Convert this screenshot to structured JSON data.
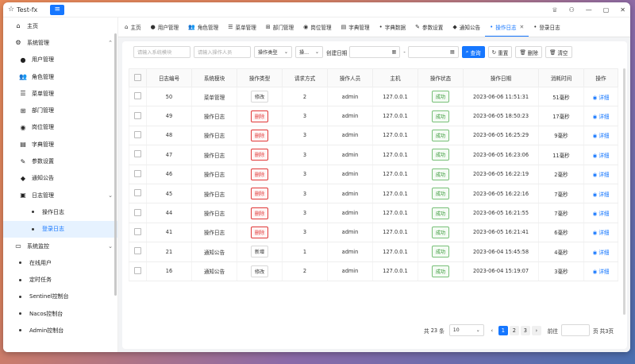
{
  "app": {
    "title": "Test-fx"
  },
  "sidebar": {
    "items": [
      {
        "label": "主页",
        "icon": "home-icon",
        "glyph": "⌂",
        "level": 0
      },
      {
        "label": "系统管理",
        "icon": "gear-icon",
        "glyph": "⚙",
        "level": 0,
        "chev": "⌃"
      },
      {
        "label": "用户管理",
        "icon": "user-icon",
        "glyph": "●",
        "level": 1
      },
      {
        "label": "角色管理",
        "icon": "users-icon",
        "glyph": "👥",
        "level": 1
      },
      {
        "label": "菜单管理",
        "icon": "menu-list-icon",
        "glyph": "☰",
        "level": 1
      },
      {
        "label": "部门管理",
        "icon": "org-chart-icon",
        "glyph": "⊞",
        "level": 1
      },
      {
        "label": "岗位管理",
        "icon": "person-badge-icon",
        "glyph": "◉",
        "level": 1
      },
      {
        "label": "字典管理",
        "icon": "book-icon",
        "glyph": "▤",
        "level": 1
      },
      {
        "label": "参数设置",
        "icon": "edit-icon",
        "glyph": "✎",
        "level": 1
      },
      {
        "label": "通知公告",
        "icon": "message-icon",
        "glyph": "◆",
        "level": 1
      },
      {
        "label": "日志管理",
        "icon": "log-icon",
        "glyph": "▣",
        "level": 1,
        "chev": "⌄"
      },
      {
        "label": "操作日志",
        "icon": "dot-icon",
        "glyph": "",
        "level": 2
      },
      {
        "label": "登录日志",
        "icon": "dot-icon",
        "glyph": "",
        "level": 2,
        "active": true
      },
      {
        "label": "系统监控",
        "icon": "monitor-icon",
        "glyph": "▭",
        "level": 0,
        "chev": "⌄"
      },
      {
        "label": "在线用户",
        "icon": "dot-icon",
        "glyph": "",
        "level": 1
      },
      {
        "label": "定时任务",
        "icon": "dot-icon",
        "glyph": "",
        "level": 1
      },
      {
        "label": "Sentinel控制台",
        "icon": "dot-icon",
        "glyph": "",
        "level": 1
      },
      {
        "label": "Nacos控制台",
        "icon": "dot-icon",
        "glyph": "",
        "level": 1
      },
      {
        "label": "Admin控制台",
        "icon": "dot-icon",
        "glyph": "",
        "level": 1
      }
    ]
  },
  "tabs": [
    {
      "label": "主页",
      "icon": "home-icon",
      "glyph": "⌂"
    },
    {
      "label": "用户管理",
      "icon": "user-icon",
      "glyph": "●"
    },
    {
      "label": "角色管理",
      "icon": "users-icon",
      "glyph": "👥"
    },
    {
      "label": "菜单管理",
      "icon": "menu-list-icon",
      "glyph": "☰"
    },
    {
      "label": "部门管理",
      "icon": "org-chart-icon",
      "glyph": "⊞"
    },
    {
      "label": "岗位管理",
      "icon": "person-badge-icon",
      "glyph": "◉"
    },
    {
      "label": "字典管理",
      "icon": "book-icon",
      "glyph": "▤"
    },
    {
      "label": "字典数据",
      "icon": "dot-icon",
      "glyph": "•"
    },
    {
      "label": "参数设置",
      "icon": "edit-icon",
      "glyph": "✎"
    },
    {
      "label": "通知公告",
      "icon": "message-icon",
      "glyph": "◆"
    },
    {
      "label": "操作日志",
      "icon": "dot-icon",
      "glyph": "•",
      "active": true,
      "close": "✕"
    },
    {
      "label": "登录日志",
      "icon": "dot-icon",
      "glyph": "•"
    }
  ],
  "filters": {
    "module_placeholder": "请输入系统模块",
    "operator_placeholder": "请输入操作人员",
    "op_type": "操作类型",
    "status": "操...",
    "create_date_label": "创建日期",
    "date_sep": "-",
    "search": "查询",
    "reset": "重置",
    "delete": "删除",
    "clear": "清空"
  },
  "table": {
    "headers": [
      "",
      "日志编号",
      "系统模块",
      "操作类型",
      "请求方式",
      "操作人员",
      "主机",
      "操作状态",
      "操作日期",
      "消耗时间",
      "操作"
    ],
    "detail_label": "详细",
    "rows": [
      {
        "id": "50",
        "module": "菜单管理",
        "type": "修改",
        "type_style": "default",
        "method": "2",
        "user": "admin",
        "host": "127.0.0.1",
        "status": "成功",
        "date": "2023-06-06 11:51:31",
        "cost": "51毫秒"
      },
      {
        "id": "49",
        "module": "操作日志",
        "type": "删除",
        "type_style": "danger",
        "method": "3",
        "user": "admin",
        "host": "127.0.0.1",
        "status": "成功",
        "date": "2023-06-05 18:50:23",
        "cost": "17毫秒"
      },
      {
        "id": "48",
        "module": "操作日志",
        "type": "删除",
        "type_style": "danger",
        "method": "3",
        "user": "admin",
        "host": "127.0.0.1",
        "status": "成功",
        "date": "2023-06-05 16:25:29",
        "cost": "9毫秒"
      },
      {
        "id": "47",
        "module": "操作日志",
        "type": "删除",
        "type_style": "danger",
        "method": "3",
        "user": "admin",
        "host": "127.0.0.1",
        "status": "成功",
        "date": "2023-06-05 16:23:06",
        "cost": "11毫秒"
      },
      {
        "id": "46",
        "module": "操作日志",
        "type": "删除",
        "type_style": "danger",
        "method": "3",
        "user": "admin",
        "host": "127.0.0.1",
        "status": "成功",
        "date": "2023-06-05 16:22:19",
        "cost": "2毫秒"
      },
      {
        "id": "45",
        "module": "操作日志",
        "type": "删除",
        "type_style": "danger",
        "method": "3",
        "user": "admin",
        "host": "127.0.0.1",
        "status": "成功",
        "date": "2023-06-05 16:22:16",
        "cost": "7毫秒"
      },
      {
        "id": "44",
        "module": "操作日志",
        "type": "删除",
        "type_style": "danger",
        "method": "3",
        "user": "admin",
        "host": "127.0.0.1",
        "status": "成功",
        "date": "2023-06-05 16:21:55",
        "cost": "7毫秒"
      },
      {
        "id": "41",
        "module": "操作日志",
        "type": "删除",
        "type_style": "danger",
        "method": "3",
        "user": "admin",
        "host": "127.0.0.1",
        "status": "成功",
        "date": "2023-06-05 16:21:41",
        "cost": "6毫秒"
      },
      {
        "id": "21",
        "module": "通知公告",
        "type": "新增",
        "type_style": "default",
        "method": "1",
        "user": "admin",
        "host": "127.0.0.1",
        "status": "成功",
        "date": "2023-06-04 15:45:58",
        "cost": "4毫秒"
      },
      {
        "id": "16",
        "module": "通知公告",
        "type": "修改",
        "type_style": "default",
        "method": "2",
        "user": "admin",
        "host": "127.0.0.1",
        "status": "成功",
        "date": "2023-06-04 15:19:07",
        "cost": "3毫秒"
      }
    ]
  },
  "pagination": {
    "total_prefix": "共",
    "total": "23",
    "total_suffix": "条",
    "page_size": "10",
    "prev": "‹",
    "next": "›",
    "pages": [
      "1",
      "2",
      "3"
    ],
    "current": "1",
    "goto_label": "前往",
    "page_suffix": "页 共3页"
  },
  "colors": {
    "accent": "#1677ff",
    "danger": "#e03a3a",
    "success": "#3a9a3a"
  }
}
